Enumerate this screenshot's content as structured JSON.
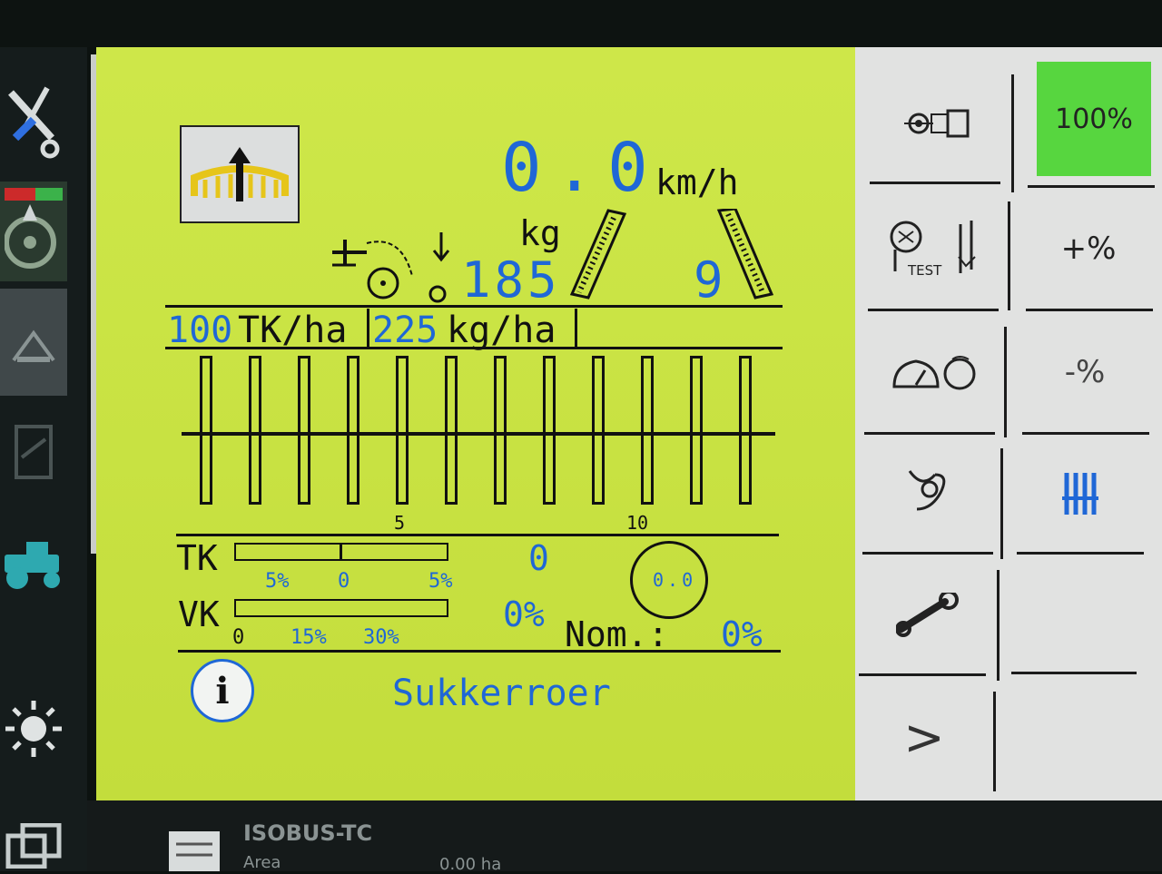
{
  "main": {
    "speed": {
      "value": "0.0",
      "unit": "km/h"
    },
    "hopper": {
      "unit": "kg",
      "value": "185"
    },
    "tramline": "9",
    "rate_tk": {
      "value": "100",
      "unit": "TK/ha"
    },
    "rate_kg": {
      "value": "225",
      "unit": "kg/ha"
    },
    "row_scale": [
      "5",
      "10"
    ],
    "tk": {
      "label": "TK",
      "scale": [
        "5%",
        "0",
        "5%"
      ],
      "value": "0"
    },
    "vk": {
      "label": "VK",
      "scale": [
        "0",
        "15%",
        "30%"
      ],
      "value": "0%"
    },
    "dial_value": "0.0",
    "nom": {
      "label": "Nom.:",
      "value": "0%"
    },
    "crop": "Sukkerroer",
    "info_letter": "i"
  },
  "softkeys": {
    "percent_100": "100%",
    "plus_percent": "+%",
    "minus_percent": "-%",
    "test_label": "TEST",
    "next": ">"
  },
  "bottom_bar": {
    "app": "ISOBUS-TC",
    "area_label": "Area",
    "area_value": "0.00 ha"
  },
  "colors": {
    "screen_bg": "#cbe63e",
    "accent_blue": "#1f67d6",
    "active_green": "#57d63f",
    "softkey_bg": "#e1e2e1"
  },
  "icons": [
    "wrench-screwdriver-icon",
    "steering-icon",
    "seeder-icon",
    "document-icon",
    "tractor-icon",
    "brightness-icon",
    "windows-icon",
    "lift-arrow-icon",
    "seeder-tramline-icon",
    "tramline-left-icon",
    "tramline-right-icon",
    "info-icon",
    "camera-icon",
    "test-icon",
    "speedometer-icon",
    "spanner-icon",
    "rows-icon",
    "chevron-right-icon"
  ]
}
